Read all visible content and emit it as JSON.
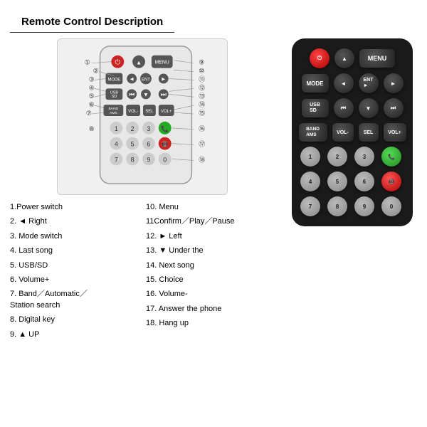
{
  "title": "Remote Control Description",
  "descriptions": {
    "col1": [
      {
        "num": "1",
        "text": "Power switch"
      },
      {
        "num": "2",
        "text": "◄ Right"
      },
      {
        "num": "3",
        "text": "Mode switch"
      },
      {
        "num": "4",
        "text": "Last song"
      },
      {
        "num": "5",
        "text": "USB/SD"
      },
      {
        "num": "6",
        "text": "Volume+"
      },
      {
        "num": "7",
        "text": "Band／Automatic／\n    Station search"
      },
      {
        "num": "8",
        "text": "Digital key"
      },
      {
        "num": "9",
        "text": "▲ UP"
      }
    ],
    "col2": [
      {
        "num": "10",
        "text": "Menu"
      },
      {
        "num": "11",
        "text": "Confirm／Play／Pause"
      },
      {
        "num": "12",
        "text": "► Left"
      },
      {
        "num": "13",
        "text": "▼ Under the"
      },
      {
        "num": "14",
        "text": "Next song"
      },
      {
        "num": "15",
        "text": "Choice"
      },
      {
        "num": "16",
        "text": "Volume-"
      },
      {
        "num": "17",
        "text": "Answer the phone"
      },
      {
        "num": "18",
        "text": "Hang up"
      }
    ]
  },
  "remote": {
    "rows": [
      {
        "buttons": [
          {
            "label": "⏻",
            "type": "power"
          },
          {
            "label": "▲",
            "type": "dark"
          },
          {
            "label": "MENU",
            "type": "dark",
            "wide": true
          }
        ]
      },
      {
        "buttons": [
          {
            "label": "MODE",
            "type": "dark",
            "wide": false
          },
          {
            "label": "◄",
            "type": "dark"
          },
          {
            "label": "ENT\n►",
            "type": "dark"
          },
          {
            "label": "►",
            "type": "dark"
          }
        ]
      },
      {
        "buttons": [
          {
            "label": "USB\nSD",
            "type": "dark"
          },
          {
            "label": "⏮",
            "type": "dark"
          },
          {
            "label": "▼",
            "type": "dark"
          },
          {
            "label": "⏭",
            "type": "dark"
          }
        ]
      },
      {
        "buttons": [
          {
            "label": "BAND\nAMS",
            "type": "dark"
          },
          {
            "label": "VOL-",
            "type": "dark"
          },
          {
            "label": "SEL",
            "type": "dark"
          },
          {
            "label": "VOL+",
            "type": "dark"
          }
        ]
      },
      {
        "buttons": [
          {
            "label": "1",
            "type": "gray"
          },
          {
            "label": "2",
            "type": "gray"
          },
          {
            "label": "3",
            "type": "gray"
          },
          {
            "label": "📞",
            "type": "green"
          }
        ]
      },
      {
        "buttons": [
          {
            "label": "4",
            "type": "gray"
          },
          {
            "label": "5",
            "type": "gray"
          },
          {
            "label": "6",
            "type": "gray"
          },
          {
            "label": "📵",
            "type": "red"
          }
        ]
      },
      {
        "buttons": [
          {
            "label": "7",
            "type": "gray"
          },
          {
            "label": "8",
            "type": "gray"
          },
          {
            "label": "9",
            "type": "gray"
          },
          {
            "label": "0",
            "type": "gray"
          }
        ]
      }
    ]
  }
}
